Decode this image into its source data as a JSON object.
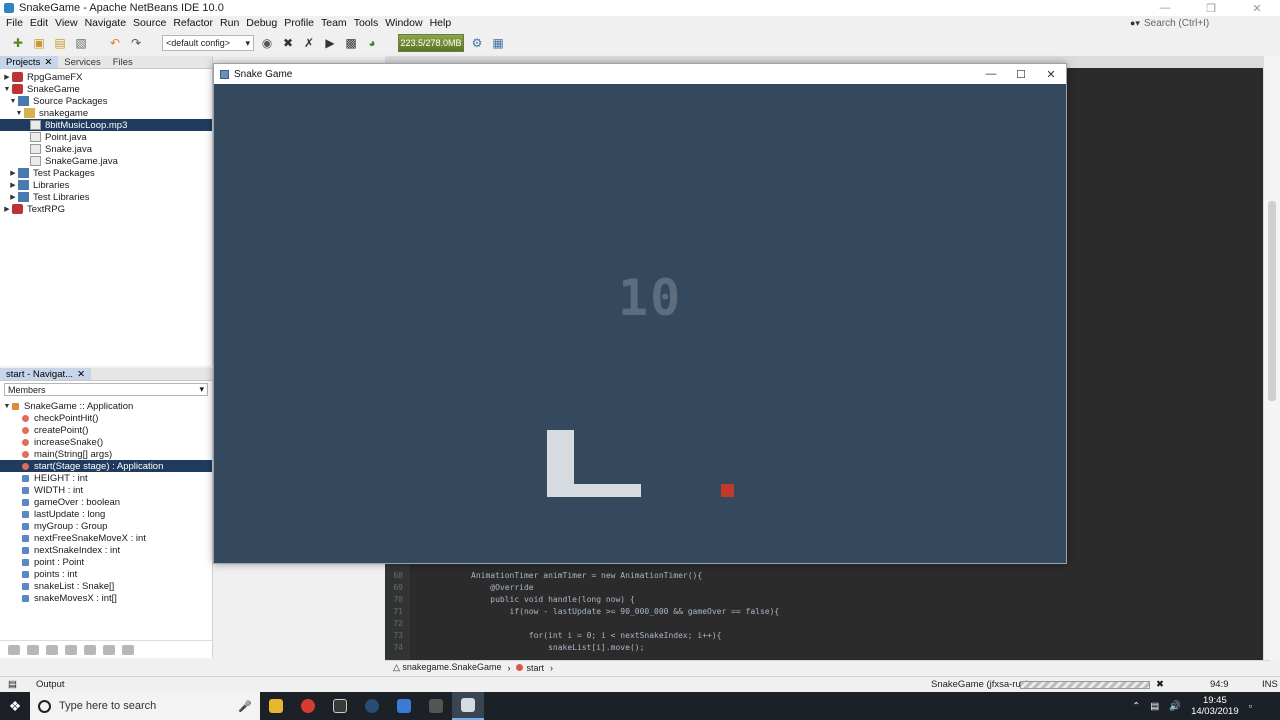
{
  "ide": {
    "window_title": "SnakeGame - Apache NetBeans IDE 10.0",
    "menus": [
      "File",
      "Edit",
      "View",
      "Navigate",
      "Source",
      "Refactor",
      "Run",
      "Debug",
      "Profile",
      "Team",
      "Tools",
      "Window",
      "Help"
    ],
    "search_placeholder": "Search (Ctrl+I)",
    "config_select": "<default config>",
    "memory": "223.5/278.0MB"
  },
  "projects_panel": {
    "tabs": [
      "Projects",
      "Services",
      "Files"
    ],
    "tree": [
      {
        "label": "RpgGameFX"
      },
      {
        "label": "SnakeGame"
      },
      {
        "label": "Source Packages"
      },
      {
        "label": "snakegame"
      },
      {
        "label": "8bitMusicLoop.mp3"
      },
      {
        "label": "Point.java"
      },
      {
        "label": "Snake.java"
      },
      {
        "label": "SnakeGame.java"
      },
      {
        "label": "Test Packages"
      },
      {
        "label": "Libraries"
      },
      {
        "label": "Test Libraries"
      },
      {
        "label": "TextRPG"
      }
    ]
  },
  "navigator": {
    "title": "start - Navigat...",
    "filter": "Members",
    "root": "SnakeGame :: Application",
    "members": [
      {
        "name": "checkPointHit()"
      },
      {
        "name": "createPoint()"
      },
      {
        "name": "increaseSnake()"
      },
      {
        "name": "main(String[] args)"
      },
      {
        "name": "start(Stage stage) : Application"
      },
      {
        "name": "HEIGHT : int"
      },
      {
        "name": "WIDTH : int"
      },
      {
        "name": "gameOver : boolean"
      },
      {
        "name": "lastUpdate : long"
      },
      {
        "name": "myGroup : Group"
      },
      {
        "name": "nextFreeSnakeMoveX : int"
      },
      {
        "name": "nextSnakeIndex : int"
      },
      {
        "name": "point : Point"
      },
      {
        "name": "points : int"
      },
      {
        "name": "snakeList : Snake[]"
      },
      {
        "name": "snakeMovesX : int[]"
      }
    ]
  },
  "editor": {
    "lines": [
      {
        "num": "68",
        "text": "AnimationTimer animTimer = new AnimationTimer(){"
      },
      {
        "num": "69",
        "text": "    @Override"
      },
      {
        "num": "70",
        "text": "    public void handle(long now) {"
      },
      {
        "num": "71",
        "text": "        if(now - lastUpdate >= 90_000_000 && gameOver == false){"
      },
      {
        "num": "72",
        "text": ""
      },
      {
        "num": "73",
        "text": "            for(int i = 0; i < nextSnakeIndex; i++){"
      },
      {
        "num": "74",
        "text": "                snakeList[i].move();"
      }
    ],
    "breadcrumb": [
      "snakegame.SnakeGame",
      "start"
    ]
  },
  "status_bar": {
    "output_label": "Output",
    "run_status": "SnakeGame (jfxsa-run)",
    "position": "94:9",
    "insert_mode": "INS"
  },
  "game_window": {
    "title": "Snake Game",
    "score": "10",
    "colors": {
      "background": "#34495e",
      "snake": "#d6dbe0",
      "food": "#c0392b",
      "score": "#5d6d7e"
    }
  },
  "taskbar": {
    "search_placeholder": "Type here to search",
    "time": "19:45",
    "date": "14/03/2019"
  }
}
